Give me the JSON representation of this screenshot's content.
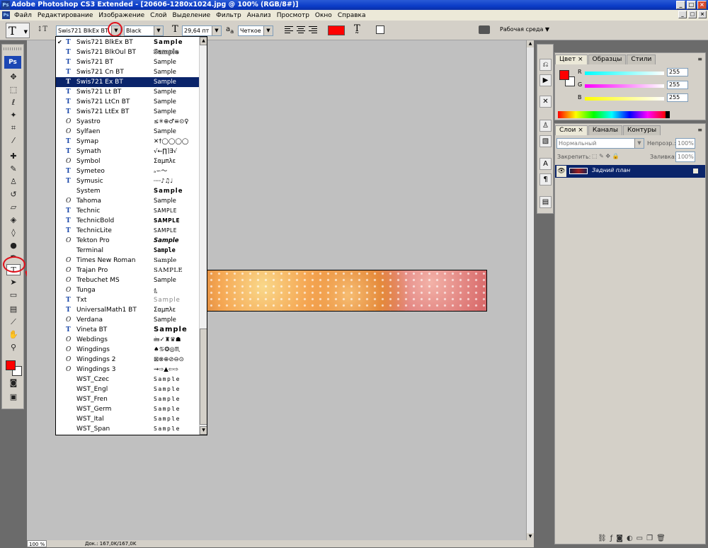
{
  "title": "Adobe Photoshop CS3 Extended - [20606-1280x1024.jpg @ 100% (RGB/8#)]",
  "app_icon": "Ps",
  "window_buttons": [
    "_",
    "□",
    "×"
  ],
  "menu": [
    "Файл",
    "Редактирование",
    "Изображение",
    "Слой",
    "Выделение",
    "Фильтр",
    "Анализ",
    "Просмотр",
    "Окно",
    "Справка"
  ],
  "options": {
    "font_family": "Swis721 BlkEx BT",
    "font_style": "Black",
    "font_size": "29,64 пт",
    "antialias_label": "a",
    "antialias_sub": "a",
    "antialias": "Четкое",
    "text_color": "#ff0000",
    "workspace": "Рабочая среда ▼"
  },
  "font_list": [
    {
      "name": "Swis721 BlkEx BT",
      "icon": "T",
      "sample": "Sample",
      "checked": true
    },
    {
      "name": "Swis721 BlkOul BT",
      "icon": "T",
      "sample": "Sample"
    },
    {
      "name": "Swis721 BT",
      "icon": "T",
      "sample": "Sample"
    },
    {
      "name": "Swis721 Cn BT",
      "icon": "T",
      "sample": "Sample"
    },
    {
      "name": "Swis721 Ex BT",
      "icon": "T",
      "sample": "Sample",
      "selected": true
    },
    {
      "name": "Swis721 Lt BT",
      "icon": "T",
      "sample": "Sample"
    },
    {
      "name": "Swis721 LtCn BT",
      "icon": "T",
      "sample": "Sample"
    },
    {
      "name": "Swis721 LtEx BT",
      "icon": "T",
      "sample": "Sample"
    },
    {
      "name": "Syastro",
      "icon": "O",
      "sample": "≤✳⊕♂≡⊙♀"
    },
    {
      "name": "Sylfaen",
      "icon": "O",
      "sample": "Sample"
    },
    {
      "name": "Symap",
      "icon": "T",
      "sample": "✕†◯◯◯◯"
    },
    {
      "name": "Symath",
      "icon": "T",
      "sample": "√←∏⌉∃√"
    },
    {
      "name": "Symbol",
      "icon": "O",
      "sample": "Σαμπλε"
    },
    {
      "name": "Symeteo",
      "icon": "T",
      "sample": "ₔ∽〜"
    },
    {
      "name": "Symusic",
      "icon": "T",
      "sample": "┈┈♪♫♩"
    },
    {
      "name": "System",
      "icon": "",
      "sample": "Sample"
    },
    {
      "name": "Tahoma",
      "icon": "O",
      "sample": "Sample"
    },
    {
      "name": "Technic",
      "icon": "T",
      "sample": "SAMPLE"
    },
    {
      "name": "TechnicBold",
      "icon": "T",
      "sample": "SAMPLE"
    },
    {
      "name": "TechnicLite",
      "icon": "T",
      "sample": "SAMPLE"
    },
    {
      "name": "Tekton Pro",
      "icon": "O",
      "sample": "Sample"
    },
    {
      "name": "Terminal",
      "icon": "",
      "sample": "Sample"
    },
    {
      "name": "Times New Roman",
      "icon": "O",
      "sample": "Sample"
    },
    {
      "name": "Trajan Pro",
      "icon": "O",
      "sample": "SAMPLE"
    },
    {
      "name": "Trebuchet MS",
      "icon": "O",
      "sample": "Sample"
    },
    {
      "name": "Tunga",
      "icon": "O",
      "sample": "ಕ್ಷಿ"
    },
    {
      "name": "Txt",
      "icon": "T",
      "sample": "Sample"
    },
    {
      "name": "UniversalMath1 BT",
      "icon": "T",
      "sample": "Σαμπλε"
    },
    {
      "name": "Verdana",
      "icon": "O",
      "sample": "Sample"
    },
    {
      "name": "Vineta BT",
      "icon": "T",
      "sample": "Sample"
    },
    {
      "name": "Webdings",
      "icon": "O",
      "sample": "🖮✓♜♛☗"
    },
    {
      "name": "Wingdings",
      "icon": "O",
      "sample": "♠♋❂◎♏"
    },
    {
      "name": "Wingdings 2",
      "icon": "O",
      "sample": "⊠⊗⊕⊘⊖⊙"
    },
    {
      "name": "Wingdings 3",
      "icon": "O",
      "sample": "⇝⇨▲⇦⇨"
    },
    {
      "name": "WST_Czec",
      "icon": "",
      "sample": "Sample"
    },
    {
      "name": "WST_Engl",
      "icon": "",
      "sample": "Sample"
    },
    {
      "name": "WST_Fren",
      "icon": "",
      "sample": "Sample"
    },
    {
      "name": "WST_Germ",
      "icon": "",
      "sample": "Sample"
    },
    {
      "name": "WST_Ital",
      "icon": "",
      "sample": "Sample"
    },
    {
      "name": "WST_Span",
      "icon": "",
      "sample": "Sample"
    }
  ],
  "color_panel": {
    "tabs": [
      "Цвет",
      "Образцы",
      "Стили"
    ],
    "close_glyph": "×",
    "channels": [
      {
        "label": "R",
        "value": "255"
      },
      {
        "label": "G",
        "value": "255"
      },
      {
        "label": "B",
        "value": "255"
      }
    ],
    "fg_color": "#ff0000"
  },
  "layers_panel": {
    "tabs": [
      "Слои",
      "Каналы",
      "Контуры"
    ],
    "close_glyph": "×",
    "blend_mode": "Нормальный",
    "opacity_label": "Непрозр.:",
    "opacity": "100%",
    "lock_label": "Закрепить:",
    "fill_label": "Заливка:",
    "fill": "100%",
    "layer_name": "Задний план"
  },
  "status": {
    "zoom": "100 %",
    "doc": "Док.: 167,0K/167,0K"
  },
  "colors": {
    "selection": "#0a246a",
    "annotation": "#e0101a"
  }
}
